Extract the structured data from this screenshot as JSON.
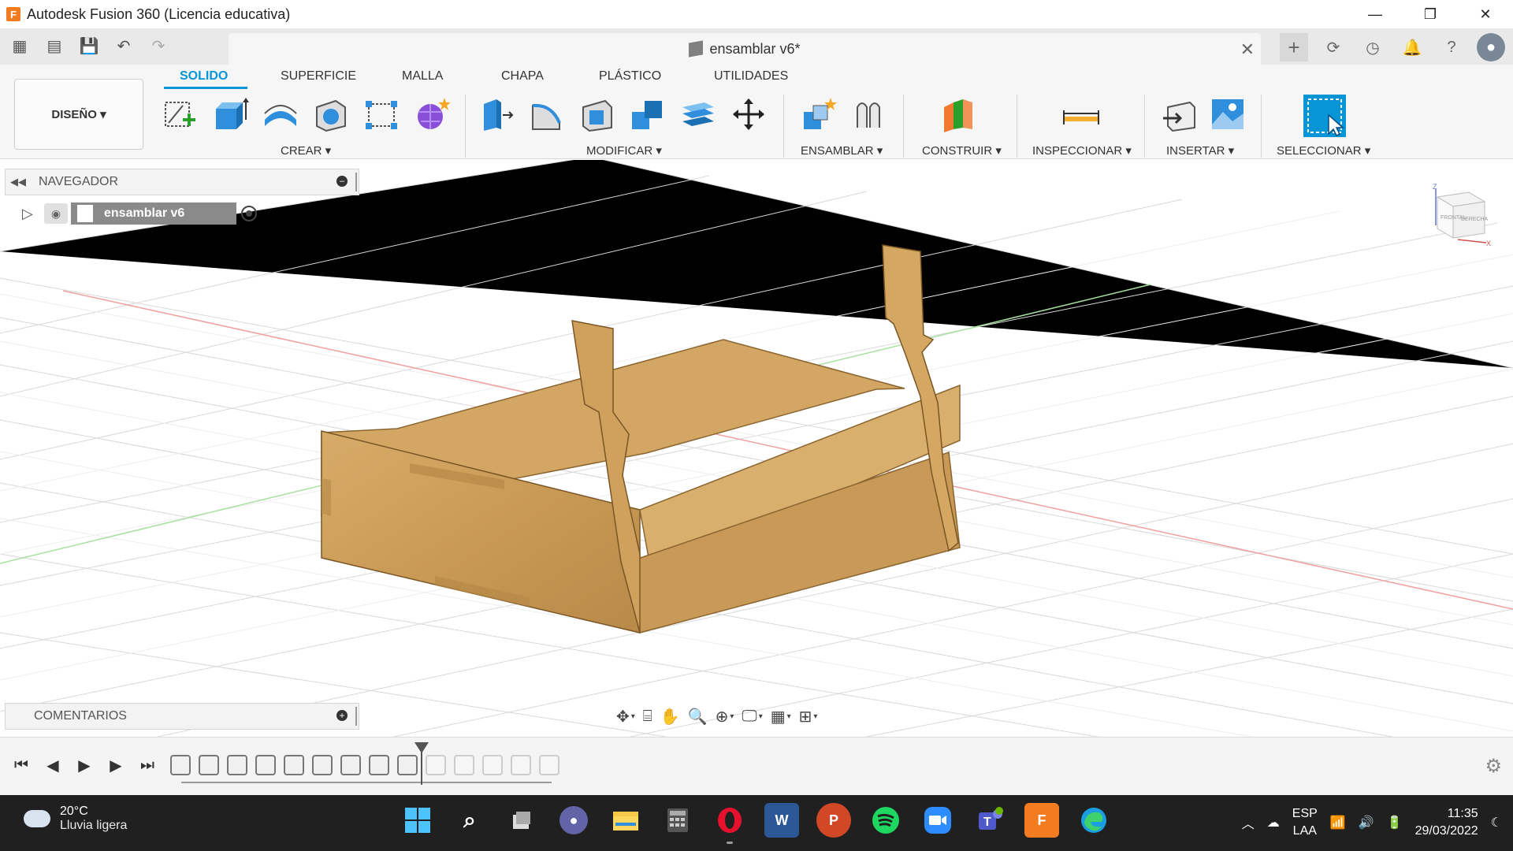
{
  "window": {
    "title": "Autodesk Fusion 360 (Licencia educativa)",
    "app_logo": "F",
    "minimize_icon": "—",
    "restore_icon": "❐",
    "close_icon": "✕"
  },
  "tabbar": {
    "document_tab": "ensamblar v6*",
    "close_icon": "✕",
    "new_tab_icon": "+"
  },
  "ribbon": {
    "workspace": "DISEÑO ▾",
    "tabs": [
      "SOLIDO",
      "SUPERFICIE",
      "MALLA",
      "CHAPA",
      "PLÁSTICO",
      "UTILIDADES"
    ],
    "active_tab": "SOLIDO",
    "groups": {
      "crear": "CREAR ▾",
      "modificar": "MODIFICAR ▾",
      "ensamblar": "ENSAMBLAR ▾",
      "construir": "CONSTRUIR ▾",
      "inspeccionar": "INSPECCIONAR ▾",
      "insertar": "INSERTAR ▾",
      "seleccionar": "SELECCIONAR ▾"
    },
    "accent_color": "#0696d7"
  },
  "navigator": {
    "title": "NAVEGADOR",
    "item_label": "ensamblar v6"
  },
  "comments": {
    "title": "COMENTARIOS"
  },
  "viewcube": {
    "front_label": "FRONTAL",
    "right_label": "DERECHA",
    "z_label": "Z",
    "x_label": "X"
  },
  "taskbar": {
    "weather_temp": "20°C",
    "weather_desc": "Lluvia ligera",
    "lang_top": "ESP",
    "lang_bottom": "LAA",
    "time": "11:35",
    "date": "29/03/2022",
    "apps": [
      "start",
      "search",
      "task-view",
      "chat",
      "file-explorer",
      "calculator",
      "opera",
      "word",
      "powerpoint",
      "spotify",
      "zoom",
      "teams",
      "fusion-360",
      "edge"
    ],
    "app_letters": {
      "word": "W",
      "powerpoint": "P",
      "fusion-360": "F"
    }
  }
}
